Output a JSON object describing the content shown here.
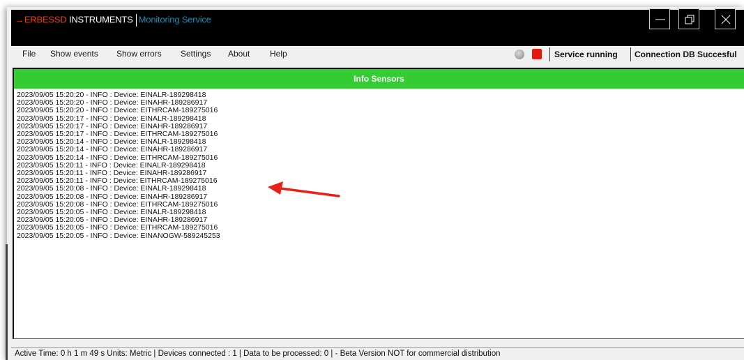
{
  "titlebar": {
    "brand_red": "ERBESSD",
    "brand_white": " INSTRUMENTS",
    "service": "Monitoring Service"
  },
  "menu": [
    "File",
    "Show events",
    "Show errors",
    "Settings",
    "About",
    "Help"
  ],
  "status": {
    "service": "Service running",
    "connection": "Connection DB Succesful"
  },
  "panel": {
    "title": "Info Sensors"
  },
  "log": [
    "2023/09/05 15:20:20 - INFO : Device: EINALR-189298418",
    "2023/09/05 15:20:20 - INFO : Device: EINAHR-189286917",
    "2023/09/05 15:20:20 - INFO : Device: EITHRCAM-189275016",
    "2023/09/05 15:20:17 - INFO : Device: EINALR-189298418",
    "2023/09/05 15:20:17 - INFO : Device: EINAHR-189286917",
    "2023/09/05 15:20:17 - INFO : Device: EITHRCAM-189275016",
    "2023/09/05 15:20:14 - INFO : Device: EINALR-189298418",
    "2023/09/05 15:20:14 - INFO : Device: EINAHR-189286917",
    "2023/09/05 15:20:14 - INFO : Device: EITHRCAM-189275016",
    "2023/09/05 15:20:11 - INFO : Device: EINALR-189298418",
    "2023/09/05 15:20:11 - INFO : Device: EINAHR-189286917",
    "2023/09/05 15:20:11 - INFO : Device: EITHRCAM-189275016",
    "2023/09/05 15:20:08 - INFO : Device: EINALR-189298418",
    "2023/09/05 15:20:08 - INFO : Device: EINAHR-189286917",
    "2023/09/05 15:20:08 - INFO : Device: EITHRCAM-189275016",
    "2023/09/05 15:20:05 - INFO : Device: EINALR-189298418",
    "2023/09/05 15:20:05 - INFO : Device: EINAHR-189286917",
    "2023/09/05 15:20:05 - INFO : Device: EITHRCAM-189275016",
    "2023/09/05 15:20:05 - INFO : Device: EINANOGW-589245253"
  ],
  "statusbar": {
    "text": "Active Time:  0 h 1 m 49 s  Units: Metric  |  Devices connected : 1  |  Data to be processed: 0  |   - Beta Version NOT for commercial distribution"
  },
  "icons": {
    "minimize": "minimize-icon",
    "restore": "restore-icon",
    "close": "close-icon"
  },
  "colors": {
    "header_green": "#33cc33",
    "status_red": "#e21b10",
    "brand_red": "#e8401c",
    "service_blue": "#1f8ab5",
    "arrow_red": "#e8201a"
  }
}
